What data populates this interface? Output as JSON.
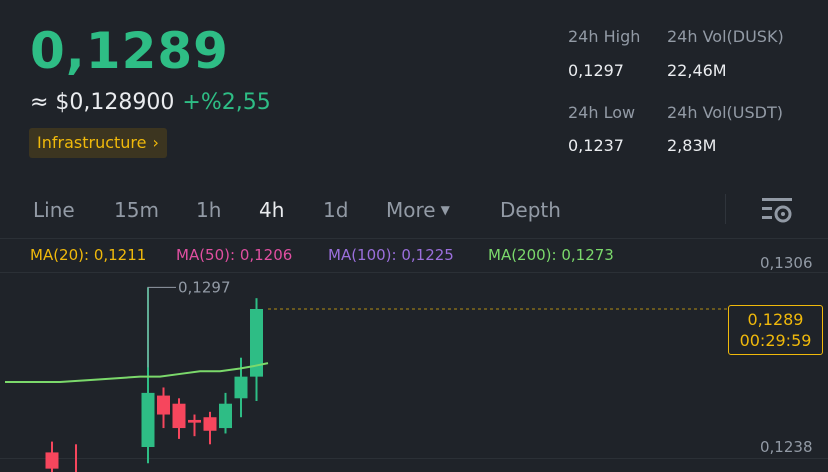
{
  "header": {
    "price": "0,1289",
    "approx_value": "≈ $0,128900",
    "change": "+%2,55",
    "tag_label": "Infrastructure",
    "tag_chevron": "›"
  },
  "stats": {
    "high_label": "24h High",
    "high_value": "0,1297",
    "vol_dusk_label": "24h Vol(DUSK)",
    "vol_dusk_value": "22,46M",
    "low_label": "24h Low",
    "low_value": "0,1237",
    "vol_usdt_label": "24h Vol(USDT)",
    "vol_usdt_value": "2,83M"
  },
  "tabs": [
    "Line",
    "15m",
    "1h",
    "4h",
    "1d",
    "More",
    "Depth"
  ],
  "active_tab": "4h",
  "icons": {
    "chart_settings": "settings-icon",
    "more_caret": "caret-down-icon"
  },
  "ma": {
    "ma20": "MA(20): 0,1211",
    "ma50": "MA(50): 0,1206",
    "ma100": "MA(100): 0,1225",
    "ma200": "MA(200): 0,1273"
  },
  "colors": {
    "up": "#2ebd85",
    "down": "#f6465d",
    "accent": "#f0b90b",
    "ma20": "#f0b90b",
    "ma50": "#e04fa1",
    "ma100": "#9b6fdc",
    "ma200": "#7bd96b"
  },
  "axis": {
    "top": "0,1306",
    "bottom": "0,1238"
  },
  "chart": {
    "high_marker_label": "0,1297",
    "current_price": "0,1289",
    "countdown": "00:29:59"
  },
  "chart_data": {
    "type": "candlestick",
    "ylim": [
      0.1238,
      0.1306
    ],
    "candles": [
      {
        "open": 0.1236,
        "close": 0.123,
        "high": 0.124,
        "low": 0.1225
      },
      {
        "open": 0.1228,
        "close": 0.1226,
        "high": 0.1239,
        "low": 0.1222
      },
      {
        "open": 0.1238,
        "close": 0.1258,
        "high": 0.1297,
        "low": 0.1232
      },
      {
        "open": 0.1257,
        "close": 0.125,
        "high": 0.126,
        "low": 0.1245
      },
      {
        "open": 0.1254,
        "close": 0.1245,
        "high": 0.1256,
        "low": 0.1241
      },
      {
        "open": 0.1248,
        "close": 0.1247,
        "high": 0.125,
        "low": 0.1242
      },
      {
        "open": 0.1249,
        "close": 0.1244,
        "high": 0.1251,
        "low": 0.1239
      },
      {
        "open": 0.1245,
        "close": 0.1254,
        "high": 0.1258,
        "low": 0.1243
      },
      {
        "open": 0.1256,
        "close": 0.1264,
        "high": 0.1271,
        "low": 0.1249
      },
      {
        "open": 0.1264,
        "close": 0.1289,
        "high": 0.1293,
        "low": 0.1255
      }
    ],
    "ma_line": [
      0.1262,
      0.1262,
      0.1263,
      0.1264,
      0.1264,
      0.1265,
      0.1266,
      0.1266,
      0.1267,
      0.1268,
      0.1269
    ]
  }
}
